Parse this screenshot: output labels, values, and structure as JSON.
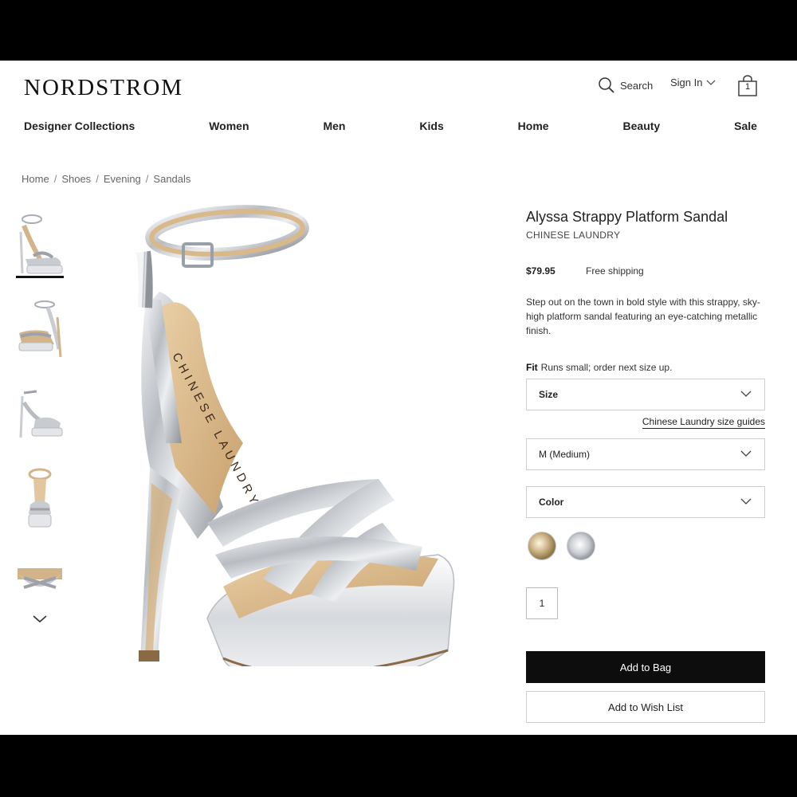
{
  "header": {
    "logo": "NORDSTROM",
    "search_label": "Search",
    "signin_label": "Sign In",
    "bag_count": "1"
  },
  "nav": {
    "items": [
      "Designer Collections",
      "Women",
      "Men",
      "Kids",
      "Home",
      "Beauty",
      "Sale"
    ]
  },
  "breadcrumb": [
    "Home",
    "Shoes",
    "Evening",
    "Sandals"
  ],
  "gallery": {
    "thumbnail_count": 5,
    "active_index": 0
  },
  "product": {
    "title": "Alyssa Strappy Platform Sandal",
    "brand": "CHINESE LAUNDRY",
    "price": "$79.95",
    "shipping": "Free shipping",
    "description": "Step out on the town in bold style with this strappy, sky-high platform sandal featuring an eye-catching metallic finish.",
    "fit_label": "Fit",
    "fit_text": "Runs small; order next size up.",
    "size_label": "Size",
    "size_guide_link": "Chinese Laundry size guides",
    "width_value": "M (Medium)",
    "color_label": "Color",
    "swatches": [
      "gold",
      "silver"
    ],
    "quantity": "1",
    "add_to_bag": "Add to Bag",
    "add_to_wishlist": "Add to Wish List",
    "shoe_brand_imprint": "CHINESE LAUNDRY"
  },
  "colors": {
    "page_bg": "#ffffff",
    "frame_bg": "#000000",
    "primary_button": "#0d0d0d",
    "text": "#222222"
  }
}
